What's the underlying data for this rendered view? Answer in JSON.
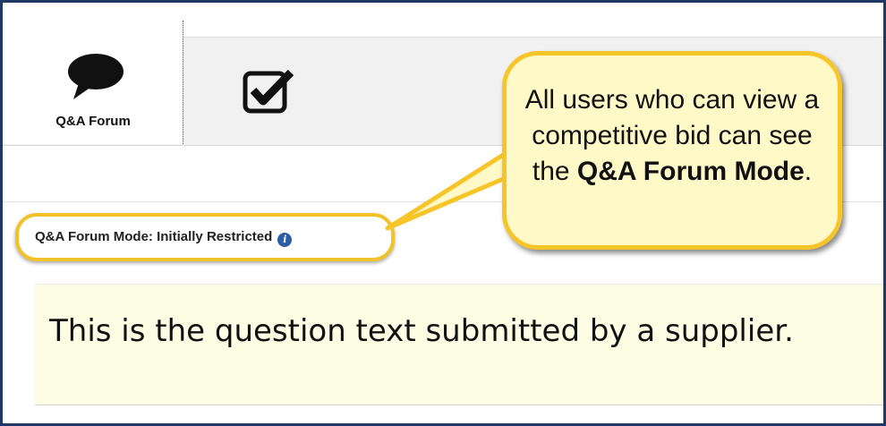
{
  "tabs": [
    {
      "label": "Q&A Forum",
      "icon": "speech-bubble-icon",
      "active": true
    },
    {
      "label": "",
      "icon": "checkbox-checked-icon",
      "active": false
    }
  ],
  "mode": {
    "label": "Q&A Forum Mode: Initially Restricted",
    "icon": "info-icon",
    "highlight_color": "#f2c22b"
  },
  "question": {
    "text": "This is the question text submitted by a supplier.",
    "background": "#fdfde4"
  },
  "callout": {
    "text_before": "All users who can view a competitive bid can see the",
    "emphasis": "Q&A Forum Mode",
    "text_after": ".",
    "fill": "#fff9c8",
    "border": "#f5c52a"
  },
  "colors": {
    "frame_border": "#1f3864",
    "tab_bar": "#f1f1f1",
    "info_icon": "#2a5ca8"
  }
}
